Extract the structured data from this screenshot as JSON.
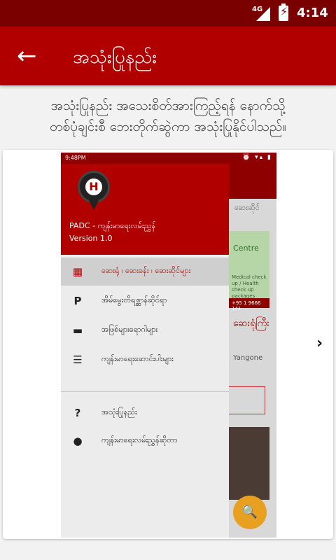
{
  "status_bar": {
    "network": "4G",
    "time": "4:14"
  },
  "app_bar": {
    "title": "အသုံးပြုနည်း"
  },
  "instructions": {
    "line1": "အသုံးပြုနည်း အသေးစိတ်အားကြည့်ရန် နောက်သို့",
    "line2": "တစ်ပုံချင်းစီ ဘေးတိုက်ဆွဲကာ အသုံးပြုနိုင်ပါသည်။"
  },
  "screenshot": {
    "status_time": "9:48PM",
    "status_icons": "⏰ ▾▴ ▮",
    "drawer": {
      "app_name": "PADC - ကျန်းမာရေးလမ်းညွှန်",
      "version": "Version 1.0",
      "items": [
        {
          "icon": "building-icon",
          "glyph": "▦",
          "label": "ဆေးရုံ ၊ ဆေးခန်း ၊ ဆေးဆိုင်များ",
          "active": true
        },
        {
          "icon": "parking-icon",
          "glyph": "P",
          "label": "အိမ်မွေးတိရစ္ဆာန်ဆိုင်ရာ",
          "active": false
        },
        {
          "icon": "bed-icon",
          "glyph": "▬",
          "label": "အဖြစ်များရောဂါများ",
          "active": false
        },
        {
          "icon": "list-icon",
          "glyph": "☰",
          "label": "ကျန်းမာရေးဆောင်းပါးများ",
          "active": false
        },
        {
          "icon": "help-icon",
          "glyph": "?",
          "label": "အသုံးပြုနည်း",
          "active": false
        },
        {
          "icon": "location-pin-icon",
          "glyph": "●",
          "label": "ကျန်းမာရေးလမ်းညွှန်ဆိုတာ",
          "active": false
        }
      ]
    },
    "background": {
      "tab_label": "ဆေးဆိုင်",
      "card_title": "Centre",
      "card_sub": "Medical check up / Health check up packages",
      "phone": "+95 1 9666 141",
      "red_heading": "ဆေးရုံကြီး",
      "city": "Yangone"
    }
  }
}
